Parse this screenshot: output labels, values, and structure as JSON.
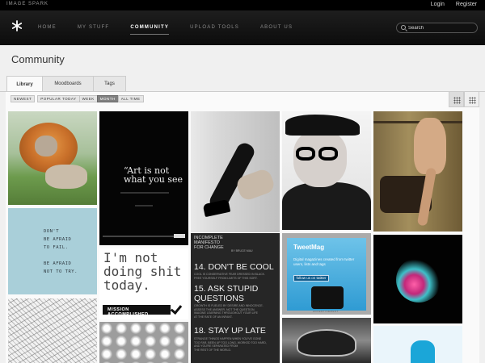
{
  "topbar": {
    "brand": "IMAGE SPARK",
    "links": {
      "login": "Login",
      "register": "Register"
    }
  },
  "nav": {
    "items": [
      "HOME",
      "MY STUFF",
      "COMMUNITY",
      "UPLOAD TOOLS",
      "ABOUT US"
    ],
    "active": "COMMUNITY",
    "search_placeholder": "Search"
  },
  "page": {
    "title": "Community"
  },
  "tabs": {
    "items": [
      "Library",
      "Moodboards",
      "Tags"
    ],
    "active": "Library"
  },
  "filters": {
    "newest": "NEWEST",
    "popular_today": "POPULAR TODAY",
    "week": "WEEK",
    "month": "MONTH",
    "all_time": "ALL TIME",
    "selected": "MONTH"
  },
  "view_toggle": {
    "selected": "large-grid-icon",
    "options": [
      "large-grid-icon",
      "small-grid-icon"
    ]
  },
  "tiles": {
    "lion_cat": {
      "icon": "lion-cat-photo"
    },
    "dont_be_afraid": {
      "text": "DON'T\nBE AFRAID\nTO FAIL.\n\nBE AFRAID\nNOT TO TRY."
    },
    "art_quote": {
      "text": "“Art is not\nwhat you see"
    },
    "not_doing": {
      "text": "I'm not\ndoing shit\ntoday.",
      "ribbon": "MISSION ACCOMPLISHED"
    },
    "manifesto": {
      "heading": "INCOMPLETE\nMANIFESTO\nFOR CHANGE",
      "byline": "BY BRUCE MAU",
      "item14": "14. DON'T BE COOL",
      "item14_body": "COOL IS CONSERVATIVE FEAR DRESSED IN BLACK.\nFREE YOURSELF FROM LIMITS OF THIS SORT.",
      "item15": "15. ASK STUPID\nQUESTIONS",
      "item15_body": "GROWTH IS FUELED BY DESIRE AND INNOCENCE.\nASSESS THE ANSWER, NOT THE QUESTION.\nIMAGINE LEARNING THROUGHOUT YOUR LIFE\nAT THE RATE OF AN INFANT.",
      "item18": "18. STAY UP LATE",
      "item18_body": "STRANGE THINGS HAPPEN WHEN YOU'VE GONE\nTOO FAR, BEEN UP TOO LONG, WORKED TOO HARD,\nAND YOU'RE SEPARATED FROM\nTHE REST OF THE WORLD."
    },
    "tweetmag": {
      "logo": "TweetMag",
      "description": "Digital magazines created from twitter users, lists and tags",
      "button": "follow us on twitter",
      "ad_label": "ADVERTISEMENT"
    }
  },
  "colors": {
    "nav_bg": "#111111",
    "page_bg": "#f0f0f0",
    "filter_selected": "#808080",
    "tweetmag_blue": "#2f9bd3"
  }
}
